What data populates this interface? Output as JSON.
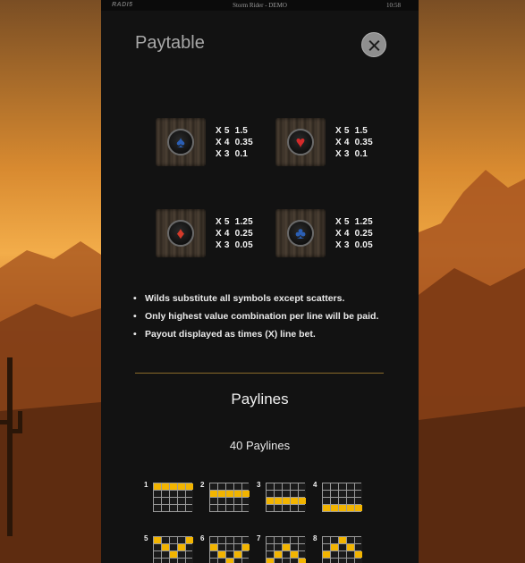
{
  "statusbar": {
    "logo": "RADI5",
    "title": "Storm Rider - DEMO",
    "time": "10:58"
  },
  "paytable": {
    "title": "Paytable",
    "close_icon": "close-icon",
    "symbols": [
      {
        "suit": "spade",
        "glyph": "♠",
        "color": "#2b5fb5",
        "pays": [
          "X 5  1.5",
          "X 4  0.35",
          "X 3  0.1"
        ]
      },
      {
        "suit": "heart",
        "glyph": "♥",
        "color": "#d42a2a",
        "pays": [
          "X 5  1.5",
          "X 4  0.35",
          "X 3  0.1"
        ]
      },
      {
        "suit": "diamond",
        "glyph": "♦",
        "color": "#d43a2a",
        "pays": [
          "X 5  1.25",
          "X 4  0.25",
          "X 3  0.05"
        ]
      },
      {
        "suit": "club",
        "glyph": "♣",
        "color": "#2b5fb5",
        "pays": [
          "X 5  1.25",
          "X 4  0.25",
          "X 3  0.05"
        ]
      }
    ],
    "rules": [
      "Wilds substitute all symbols except scatters.",
      "Only highest value combination per line will be paid.",
      "Payout displayed as times (X) line bet."
    ]
  },
  "paylines": {
    "title": "Paylines",
    "count_label": "40 Paylines",
    "lines": [
      {
        "number": "1",
        "rows": [
          1,
          1,
          1,
          1,
          1
        ]
      },
      {
        "number": "2",
        "rows": [
          2,
          2,
          2,
          2,
          2
        ]
      },
      {
        "number": "3",
        "rows": [
          3,
          3,
          3,
          3,
          3
        ]
      },
      {
        "number": "4",
        "rows": [
          4,
          4,
          4,
          4,
          4
        ]
      },
      {
        "number": "5",
        "rows": [
          1,
          2,
          3,
          2,
          1
        ]
      },
      {
        "number": "6",
        "rows": [
          2,
          3,
          4,
          3,
          2
        ]
      },
      {
        "number": "7",
        "rows": [
          4,
          3,
          2,
          3,
          4
        ]
      },
      {
        "number": "8",
        "rows": [
          3,
          2,
          1,
          2,
          3
        ]
      }
    ]
  }
}
